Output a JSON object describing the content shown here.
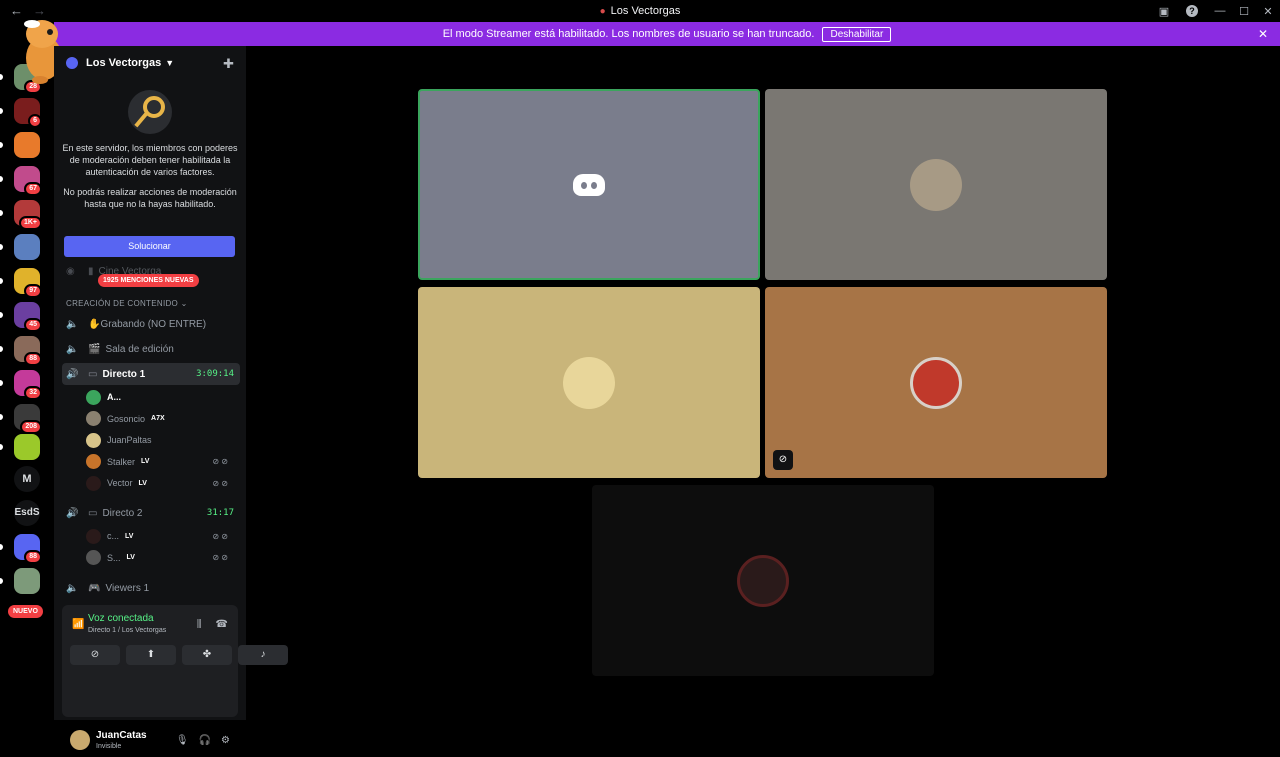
{
  "window": {
    "title": "Los Vectorgas",
    "back": "←",
    "forward": "→"
  },
  "banner": {
    "text": "El modo Streamer está habilitado. Los nombres de usuario se han truncado.",
    "button": "Deshabilitar"
  },
  "rail": {
    "servers": [
      {
        "name": "server-1",
        "badge": "28",
        "color": "#6d8f6a"
      },
      {
        "name": "server-2",
        "badge": "6",
        "color": "#7a1d1d"
      },
      {
        "name": "server-3",
        "badge": "",
        "color": "#e87a2b"
      },
      {
        "name": "server-4",
        "badge": "67",
        "color": "#c14b8c"
      },
      {
        "name": "server-5",
        "badge": "1K+",
        "color": "#b33a3a"
      },
      {
        "name": "server-6",
        "badge": "",
        "color": "#5b7fbf"
      },
      {
        "name": "server-7",
        "badge": "97",
        "color": "#e0b22b"
      },
      {
        "name": "server-8",
        "badge": "45",
        "color": "#6b3fa0"
      },
      {
        "name": "server-9",
        "badge": "88",
        "color": "#8a6a5a"
      },
      {
        "name": "server-10",
        "badge": "32",
        "color": "#c43a9a"
      },
      {
        "name": "server-11",
        "badge": "208",
        "color": "#3a3a3a"
      },
      {
        "name": "server-12",
        "badge": "",
        "color": "#9bc92a"
      },
      {
        "name": "server-13",
        "badge": "88",
        "color": "#5865f2"
      },
      {
        "name": "server-14",
        "badge": "",
        "color": "#7d9a7a"
      }
    ],
    "text_servers": [
      "M",
      "EsdS"
    ],
    "nuevo": "NUEVO"
  },
  "sidebar": {
    "server_name": "Los Vectorgas",
    "mfa_text_1": "En este servidor, los miembros con poderes de moderación deben tener habilitada la autenticación de varios factores.",
    "mfa_text_2": "No podrás realizar acciones de moderación hasta que no la hayas habilitado.",
    "solve_button": "Solucionar",
    "cine": "Cine Vectorga",
    "mentions": "1925 MENCIONES NUEVAS",
    "category": "CREACIÓN DE CONTENIDO",
    "channels": {
      "grabando": "✋Grabando (NO ENTRE)",
      "sala": "Sala de edición",
      "directo1": "Directo 1",
      "directo1_time": "3:09:14",
      "directo2": "Directo 2",
      "directo2_time": "31:17",
      "viewers": "Viewers 1"
    },
    "directo1_users": [
      {
        "name": "A...",
        "tag": ""
      },
      {
        "name": "Gosoncio",
        "tag": "A7X"
      },
      {
        "name": "JuanPaltas",
        "tag": ""
      },
      {
        "name": "Stalker",
        "tag": "LV"
      },
      {
        "name": "Vector",
        "tag": "LV"
      }
    ],
    "directo2_users": [
      {
        "name": "c...",
        "tag": "LV"
      },
      {
        "name": "S...",
        "tag": "LV"
      }
    ]
  },
  "voice": {
    "status": "Voz conectada",
    "location": "Directo 1 / Los Vectorgas"
  },
  "me": {
    "name": "JuanCatas",
    "status": "Invisible"
  },
  "colors": {
    "accent": "#5865f2",
    "streamer": "#8b2be2",
    "green": "#57f287",
    "red": "#f23f43"
  },
  "tiles": [
    {
      "name": "tile-discord",
      "color": "#7a7d8c"
    },
    {
      "name": "tile-2",
      "color": "#7a7772"
    },
    {
      "name": "tile-3",
      "color": "#c9b57a"
    },
    {
      "name": "tile-4",
      "color": "#a77446"
    },
    {
      "name": "tile-5",
      "color": "#0d0d0d"
    }
  ]
}
